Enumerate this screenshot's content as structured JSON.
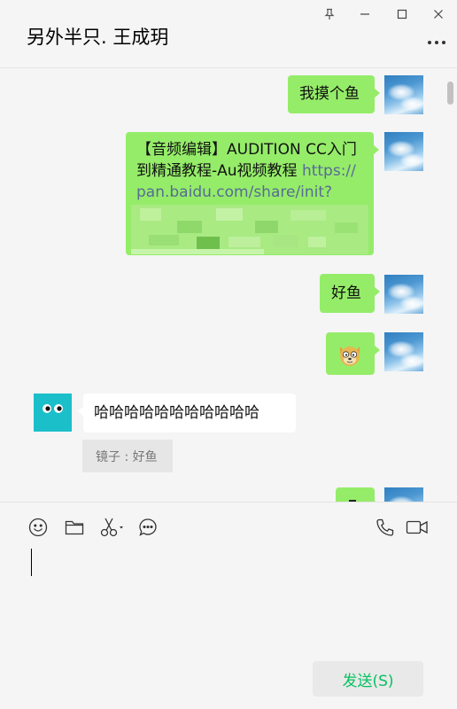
{
  "chat": {
    "title": "另外半只. 王成玥"
  },
  "messages": {
    "m1": "我摸个鱼",
    "m2_text": "【音频编辑】AUDITION CC入门到精通教程-Au视频教程 ",
    "m2_link": "https://pan.baidu.com/share/init?",
    "m3": "好鱼",
    "m4_emoji": "doge-emoji",
    "m5": "哈哈哈哈哈哈哈哈哈哈哈",
    "m5_quote": "镜子 : 好鱼"
  },
  "input": {
    "send_label": "发送(S)"
  },
  "icons": {
    "pin": "pin-icon",
    "minimize": "minimize-icon",
    "maximize": "maximize-icon",
    "close": "close-icon",
    "more": "more-icon",
    "emoji": "emoji-icon",
    "folder": "folder-icon",
    "scissors": "scissors-icon",
    "chat": "chat-bubble-icon",
    "phone": "phone-icon",
    "video": "video-icon"
  },
  "colors": {
    "my_bubble": "#95ec69",
    "their_bubble": "#ffffff",
    "link": "#576b95",
    "send_text": "#07c160",
    "other_avatar": "#1bbfc9"
  }
}
